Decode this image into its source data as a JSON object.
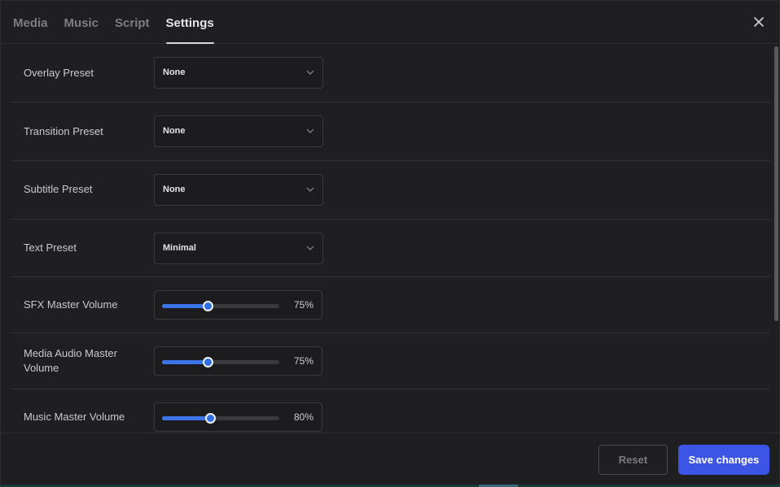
{
  "tabs": [
    {
      "label": "Media",
      "active": false
    },
    {
      "label": "Music",
      "active": false
    },
    {
      "label": "Script",
      "active": false
    },
    {
      "label": "Settings",
      "active": true
    }
  ],
  "icons": {
    "close": "close-icon",
    "chevron": "chevron-down-icon"
  },
  "settings": {
    "overlay_preset": {
      "label": "Overlay Preset",
      "value": "None"
    },
    "transition_preset": {
      "label": "Transition Preset",
      "value": "None"
    },
    "subtitle_preset": {
      "label": "Subtitle Preset",
      "value": "None"
    },
    "text_preset": {
      "label": "Text Preset",
      "value": "Minimal"
    },
    "sfx_volume": {
      "label": "SFX Master Volume",
      "display": "75%",
      "level": 0.39
    },
    "media_audio_volume": {
      "label": "Media Audio Master Volume",
      "display": "75%",
      "level": 0.39
    },
    "music_volume": {
      "label": "Music Master Volume",
      "display": "80%",
      "level": 0.41
    }
  },
  "footer": {
    "reset_label": "Reset",
    "save_label": "Save changes"
  },
  "colors": {
    "accent": "#3d55e6",
    "slider_fill": "#3a74e6",
    "background": "#1f1f21"
  }
}
